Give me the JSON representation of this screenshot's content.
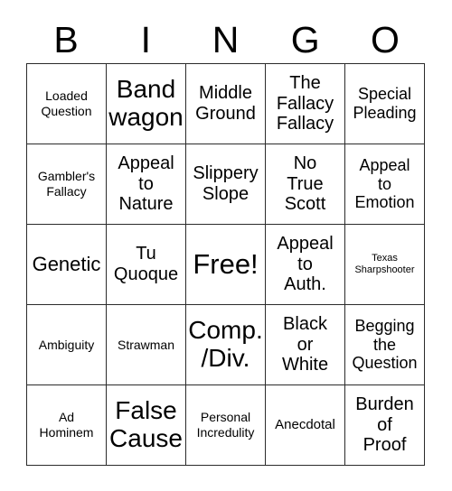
{
  "card": {
    "title_letters": [
      "B",
      "I",
      "N",
      "G",
      "O"
    ],
    "free_space_label": "Free!",
    "grid_size": "5x5",
    "border_color": "#2b2b2b",
    "background_color": "#ffffff",
    "text_color": "#000000"
  },
  "rows": [
    [
      {
        "text": "Loaded\nQuestion",
        "size": "s"
      },
      {
        "text": "Band\nwagon",
        "size": "xxl"
      },
      {
        "text": "Middle\nGround",
        "size": "ml"
      },
      {
        "text": "The\nFallacy\nFallacy",
        "size": "ml"
      },
      {
        "text": "Special\nPleading",
        "size": "m"
      }
    ],
    [
      {
        "text": "Gambler's\nFallacy",
        "size": "s"
      },
      {
        "text": "Appeal\nto\nNature",
        "size": "ml"
      },
      {
        "text": "Slippery\nSlope",
        "size": "ml"
      },
      {
        "text": "No\nTrue\nScott",
        "size": "ml"
      },
      {
        "text": "Appeal\nto\nEmotion",
        "size": "m"
      }
    ],
    [
      {
        "text": "Genetic",
        "size": "l"
      },
      {
        "text": "Tu\nQuoque",
        "size": "ml"
      },
      {
        "text": "Free!",
        "size": "free"
      },
      {
        "text": "Appeal\nto\nAuth.",
        "size": "ml"
      },
      {
        "text": "Texas\nSharpshooter",
        "size": "xs"
      }
    ],
    [
      {
        "text": "Ambiguity",
        "size": "s"
      },
      {
        "text": "Strawman",
        "size": "s"
      },
      {
        "text": "Comp.\n/Div.",
        "size": "xxl"
      },
      {
        "text": "Black\nor\nWhite",
        "size": "ml"
      },
      {
        "text": "Begging\nthe\nQuestion",
        "size": "m"
      }
    ],
    [
      {
        "text": "Ad\nHominem",
        "size": "s"
      },
      {
        "text": "False\nCause",
        "size": "xxl"
      },
      {
        "text": "Personal\nIncredulity",
        "size": "s"
      },
      {
        "text": "Anecdotal",
        "size": "sm"
      },
      {
        "text": "Burden\nof\nProof",
        "size": "ml"
      }
    ]
  ]
}
